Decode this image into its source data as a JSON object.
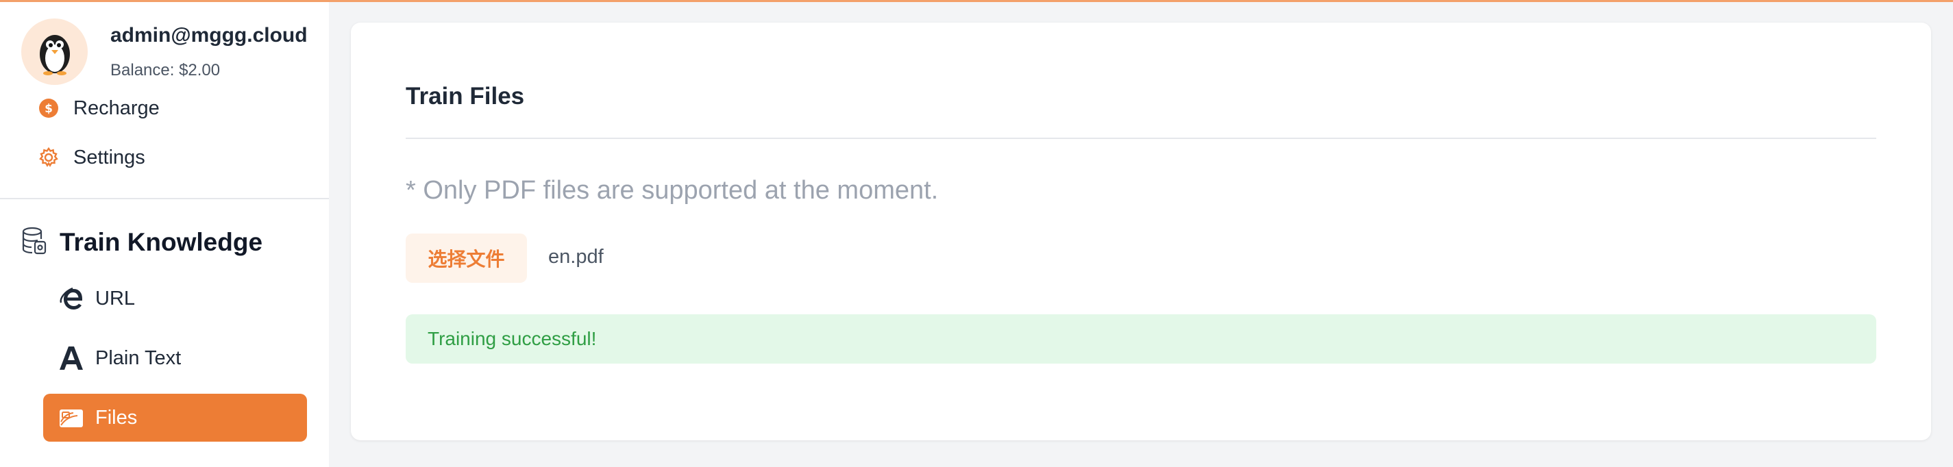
{
  "user": {
    "email": "admin@mggg.cloud",
    "balance": "Balance: $2.00",
    "avatar_icon": "penguin-avatar-icon"
  },
  "menu": [
    {
      "label": "Recharge",
      "icon": "dollar-coin-icon"
    },
    {
      "label": "Settings",
      "icon": "gear-icon"
    }
  ],
  "section": {
    "title": "Train Knowledge",
    "icon": "database-icon"
  },
  "nav": [
    {
      "label": "URL",
      "icon": "internet-explorer-icon",
      "active": false
    },
    {
      "label": "Plain Text",
      "icon": "letter-a-icon",
      "active": false
    },
    {
      "label": "Files",
      "icon": "files-icon",
      "active": true
    }
  ],
  "main": {
    "title": "Train Files",
    "note": "* Only PDF files are supported at the moment.",
    "file_button_label": "选择文件",
    "file_name": "en.pdf",
    "status_message": "Training successful!"
  },
  "colors": {
    "accent": "#ed7d35",
    "success_bg": "#e3f8e8",
    "success_text": "#2f9e44"
  }
}
